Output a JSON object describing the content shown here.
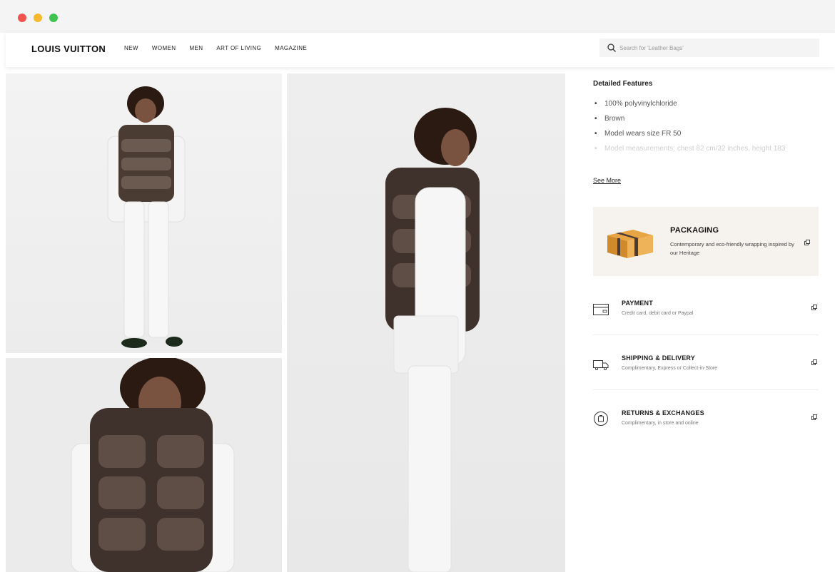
{
  "brand": {
    "logo_text": "LOUIS VUITTON"
  },
  "nav": {
    "items": [
      {
        "label": "NEW"
      },
      {
        "label": "WOMEN"
      },
      {
        "label": "MEN"
      },
      {
        "label": "ART OF LIVING"
      },
      {
        "label": "MAGAZINE"
      }
    ]
  },
  "search": {
    "placeholder": "Search for 'Leather Bags'",
    "icon": "search-icon"
  },
  "details": {
    "title": "Detailed Features",
    "features": [
      "100% polyvinylchloride",
      "Brown",
      "Model wears size FR 50",
      "Model measurements: chest 82 cm/32 inches, height 183"
    ],
    "see_more": "See More"
  },
  "packaging": {
    "title": "PACKAGING",
    "text": "Contemporary and eco-friendly wrapping inspired by our Heritage",
    "icon": "external-link-icon"
  },
  "services": [
    {
      "title": "PAYMENT",
      "text": "Credit card, debit card or Paypal",
      "icon": "card-icon"
    },
    {
      "title": "SHIPPING & DELIVERY",
      "text": "Complimentary, Express or Collect-in-Store",
      "icon": "truck-icon"
    },
    {
      "title": "RETURNS & EXCHANGES",
      "text": "Complimentary, in store and online",
      "icon": "returns-icon"
    }
  ],
  "colors": {
    "chrome_bg": "#f4f4f4",
    "packaging_bg": "#f6f2ee",
    "traffic_red": "#f0524d",
    "traffic_yellow": "#f5b82e",
    "traffic_green": "#3fc350"
  }
}
